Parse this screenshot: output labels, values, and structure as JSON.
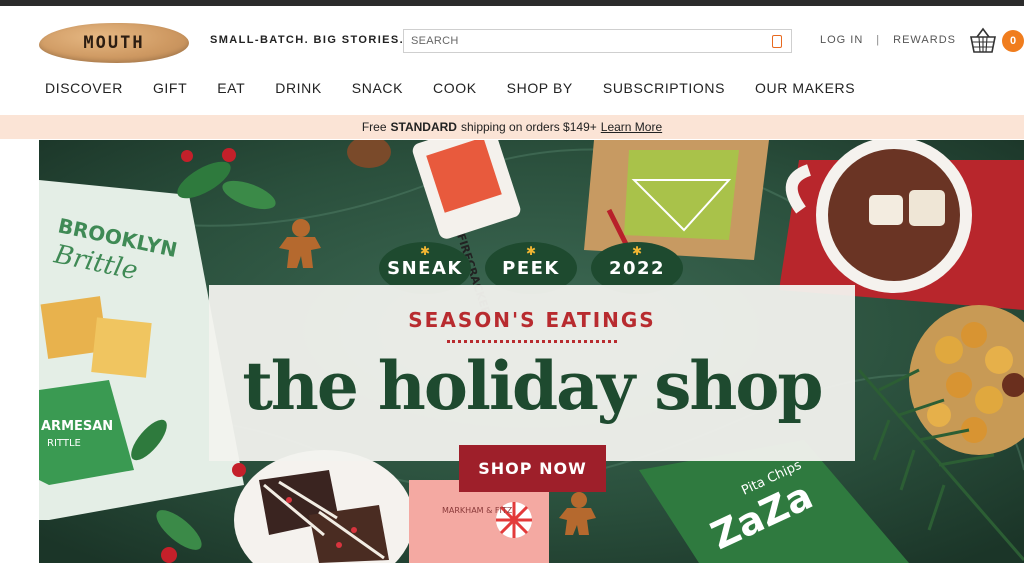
{
  "brand": {
    "logo_text": "MOUTH",
    "tagline": "SMALL-BATCH. BIG STORIES."
  },
  "search": {
    "placeholder": "SEARCH"
  },
  "account": {
    "login_label": "LOG IN",
    "separator": "|",
    "rewards_label": "REWARDS"
  },
  "cart": {
    "count": "0",
    "badge_color": "#f07d1e"
  },
  "nav": {
    "items": [
      {
        "label": "DISCOVER"
      },
      {
        "label": "GIFT"
      },
      {
        "label": "EAT"
      },
      {
        "label": "DRINK"
      },
      {
        "label": "SNACK"
      },
      {
        "label": "COOK"
      },
      {
        "label": "SHOP BY"
      },
      {
        "label": "SUBSCRIPTIONS"
      },
      {
        "label": "OUR MAKERS"
      }
    ]
  },
  "promo": {
    "prefix": "Free",
    "highlight": "STANDARD",
    "suffix": "shipping on orders $149+",
    "link_label": "Learn More",
    "background": "#fbe4d6"
  },
  "hero": {
    "badges": [
      "SNEAK",
      "PEEK",
      "2022"
    ],
    "kicker": "SEASON'S EATINGS",
    "headline": "the holiday shop",
    "cta_label": "SHOP NOW",
    "colors": {
      "green": "#1e4a2f",
      "red": "#b82b2f",
      "cta": "#9e1f2a",
      "star": "#f2b632"
    },
    "product_labels": {
      "brittle_brand": "BROOKLYN",
      "brittle_name": "Brittle",
      "parmesan": "ARMESAN",
      "parmesan_sub": "RITTLE",
      "can": "FIRECRACKER",
      "pouch": "Pita Chips",
      "pouch_brand": "ZaZa",
      "box_brand": "MARKHAM & FITZ"
    }
  }
}
